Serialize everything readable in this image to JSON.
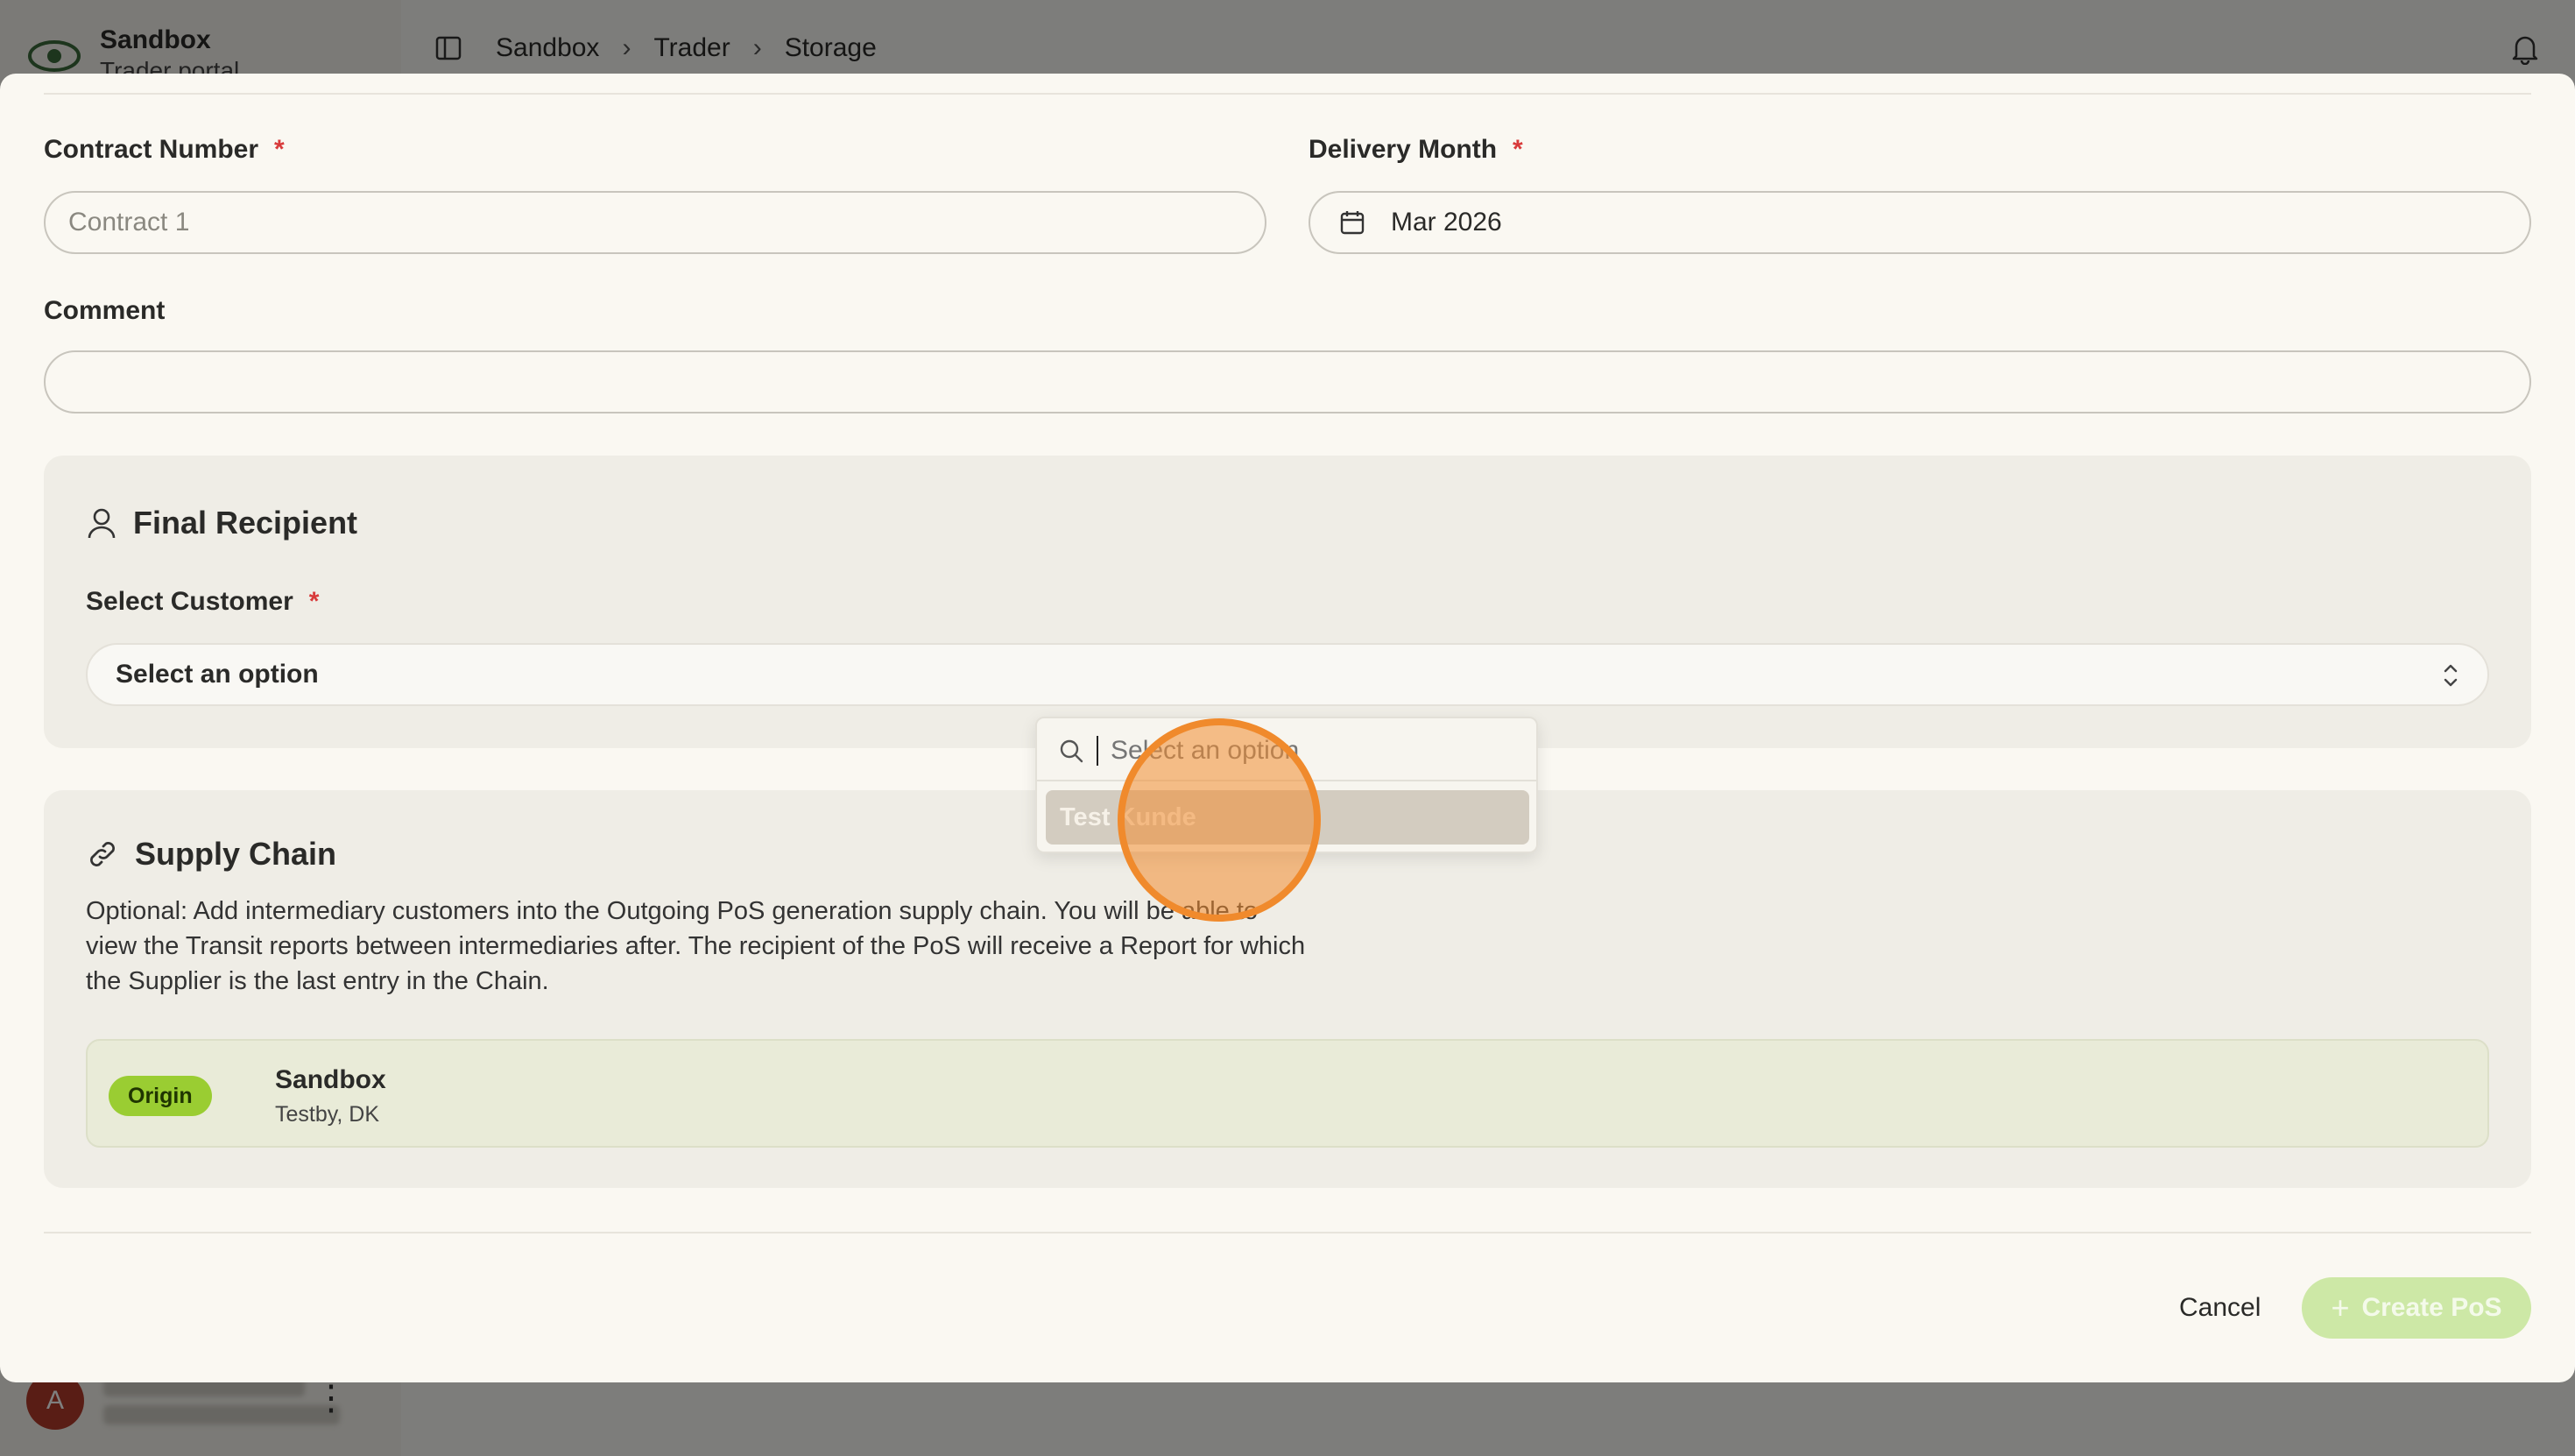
{
  "app": {
    "brand_name": "Sandbox",
    "brand_sub": "Trader portal",
    "user_initial": "A"
  },
  "breadcrumb": [
    "Sandbox",
    "Trader",
    "Storage"
  ],
  "form": {
    "contract_number": {
      "label": "Contract Number",
      "required_mark": "*",
      "value": "Contract 1"
    },
    "delivery_month": {
      "label": "Delivery Month",
      "required_mark": "*",
      "value": "Mar 2026"
    },
    "comment": {
      "label": "Comment",
      "value": ""
    }
  },
  "final_recipient": {
    "title": "Final Recipient",
    "select_label": "Select Customer",
    "required_mark": "*",
    "select_value": "Select an option"
  },
  "dropdown": {
    "search_placeholder": "Select an option",
    "options": [
      "Test Kunde"
    ]
  },
  "supply_chain": {
    "title": "Supply Chain",
    "description": "Optional: Add intermediary customers into the Outgoing PoS generation supply chain. You will be able to view the Transit reports between intermediaries after. The recipient of the PoS will receive a Report for which the Supplier is the last entry in the Chain.",
    "origin": {
      "badge": "Origin",
      "name": "Sandbox",
      "location": "Testby, DK"
    }
  },
  "actions": {
    "cancel_label": "Cancel",
    "create_label": "Create PoS"
  },
  "colors": {
    "accent_green": "#9acd32",
    "required_red": "#d83a3a",
    "click_marker": "#f08a2c"
  }
}
